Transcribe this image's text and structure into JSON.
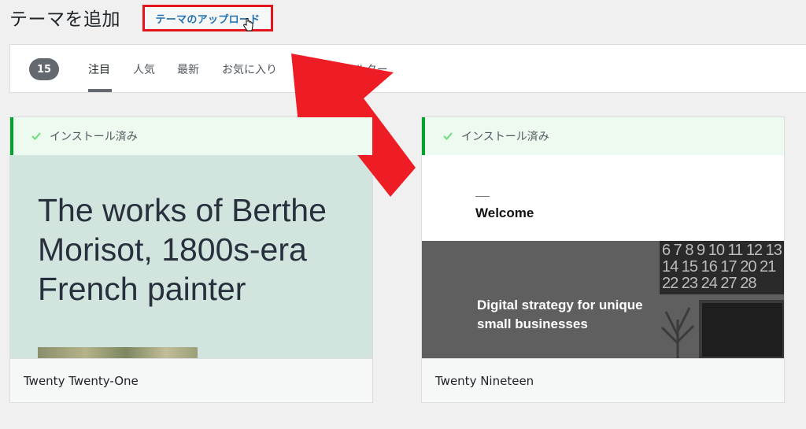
{
  "header": {
    "title": "テーマを追加",
    "upload_button": "テーマのアップロード"
  },
  "filter_bar": {
    "count": "15",
    "tabs": [
      {
        "label": "注目",
        "active": true
      },
      {
        "label": "人気",
        "active": false
      },
      {
        "label": "最新",
        "active": false
      },
      {
        "label": "お気に入り",
        "active": false
      },
      {
        "label": "特徴フィルター",
        "active": false
      }
    ]
  },
  "themes": [
    {
      "name": "Twenty Twenty-One",
      "installed_label": "インストール済み",
      "preview": {
        "heading": "The works of Berthe Morisot, 1800s-era French painter"
      }
    },
    {
      "name": "Twenty Nineteen",
      "installed_label": "インストール済み",
      "preview": {
        "welcome": "Welcome",
        "hero_text": "Digital strategy for unique small businesses",
        "calendar_numbers": "6 7 8 9 10 11 12 13 14 15 16 17 20 21 22 23 24 27 28"
      }
    }
  ],
  "colors": {
    "accent": "#2271b1",
    "success": "#00a32a",
    "highlight": "#e3161b"
  }
}
